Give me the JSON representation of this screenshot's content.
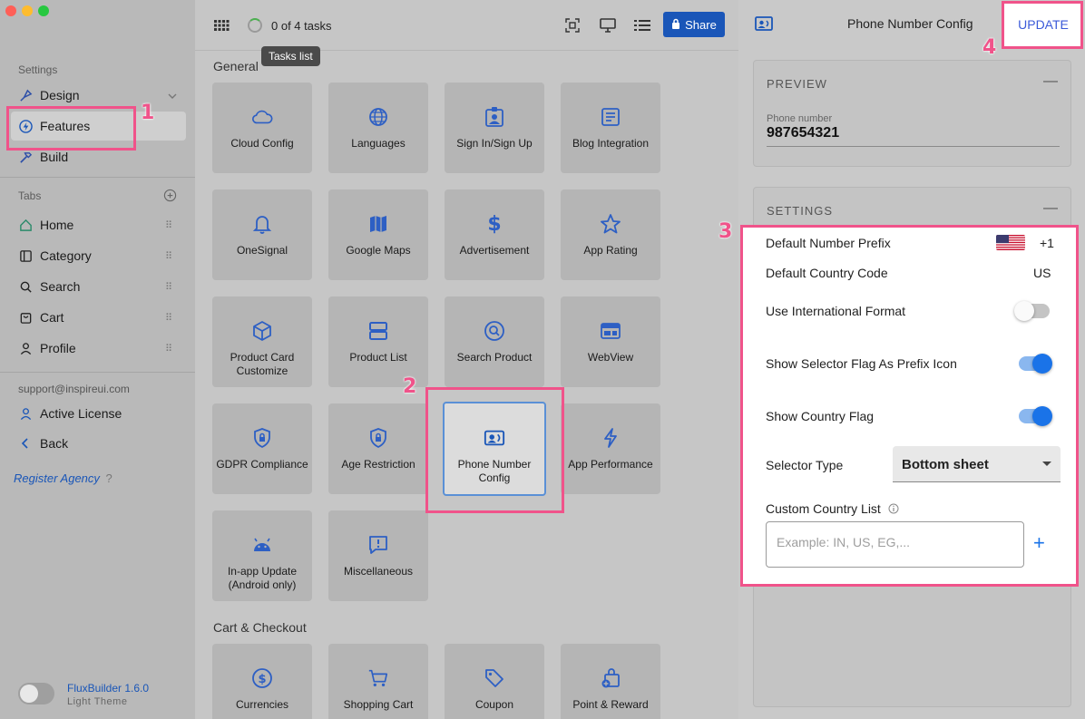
{
  "window": {
    "traffic_colors": [
      "#ff5f57",
      "#febc2e",
      "#28c840"
    ]
  },
  "sidebar": {
    "settings_header": "Settings",
    "settings_items": [
      {
        "label": "Design",
        "icon": "paintbrush-icon"
      },
      {
        "label": "Features",
        "icon": "bolt-icon"
      },
      {
        "label": "Build",
        "icon": "hammer-icon"
      }
    ],
    "tabs_header": "Tabs",
    "tabs": [
      {
        "label": "Home",
        "icon": "home-icon"
      },
      {
        "label": "Category",
        "icon": "category-icon"
      },
      {
        "label": "Search",
        "icon": "search-icon"
      },
      {
        "label": "Cart",
        "icon": "cart-icon"
      },
      {
        "label": "Profile",
        "icon": "person-icon"
      }
    ],
    "support_email": "support@inspireui.com",
    "active_license": "Active License",
    "back": "Back",
    "register_agency": "Register Agency",
    "register_help": "?",
    "app_version": "FluxBuilder 1.6.0",
    "theme_label": "Light Theme"
  },
  "annotations": [
    "1",
    "2",
    "3",
    "4"
  ],
  "topbar": {
    "tasks": "0 of 4 tasks",
    "tooltip": "Tasks list",
    "share": "Share"
  },
  "groups": {
    "general": "General",
    "cart_checkout": "Cart & Checkout"
  },
  "tiles": {
    "general": [
      {
        "label": "Cloud Config",
        "icon": "cloud-icon"
      },
      {
        "label": "Languages",
        "icon": "globe-icon"
      },
      {
        "label": "Sign In/Sign Up",
        "icon": "badge-icon"
      },
      {
        "label": "Blog Integration",
        "icon": "article-icon"
      },
      {
        "label": "OneSignal",
        "icon": "bell-icon"
      },
      {
        "label": "Google Maps",
        "icon": "map-icon"
      },
      {
        "label": "Advertisement",
        "icon": "dollar-icon"
      },
      {
        "label": "App Rating",
        "icon": "star-icon"
      },
      {
        "label": "Product Card Customize",
        "icon": "cube-icon"
      },
      {
        "label": "Product List",
        "icon": "list-icon"
      },
      {
        "label": "Search Product",
        "icon": "search-circle-icon"
      },
      {
        "label": "WebView",
        "icon": "web-icon"
      },
      {
        "label": "GDPR Compliance",
        "icon": "shield-lock-icon"
      },
      {
        "label": "Age Restriction",
        "icon": "shield-lock-icon"
      },
      {
        "label": "Phone Number Config",
        "icon": "contact-card-icon"
      },
      {
        "label": "App Performance",
        "icon": "lightning-icon"
      },
      {
        "label": "In-app Update (Android only)",
        "icon": "android-icon"
      },
      {
        "label": "Miscellaneous",
        "icon": "chat-alert-icon"
      }
    ],
    "cart_checkout": [
      {
        "label": "Currencies",
        "icon": "currency-icon"
      },
      {
        "label": "Shopping Cart",
        "icon": "shopping-cart-icon"
      },
      {
        "label": "Coupon",
        "icon": "tag-icon"
      },
      {
        "label": "Point & Reward",
        "icon": "gift-icon"
      }
    ]
  },
  "right_panel": {
    "title": "Phone Number Config",
    "update": "UPDATE",
    "preview": {
      "header": "PREVIEW",
      "collapse": "—",
      "phone_label": "Phone number",
      "phone_value": "987654321"
    },
    "settings": {
      "header": "SETTINGS",
      "collapse": "—",
      "default_prefix_label": "Default Number Prefix",
      "default_prefix_value": "+1",
      "default_country_label": "Default Country Code",
      "default_country_value": "US",
      "intl_format_label": "Use International Format",
      "intl_format_on": false,
      "selector_flag_label": "Show Selector Flag As Prefix Icon",
      "selector_flag_on": true,
      "country_flag_label": "Show Country Flag",
      "country_flag_on": true,
      "selector_type_label": "Selector Type",
      "selector_type_value": "Bottom sheet",
      "custom_list_label": "Custom Country List",
      "custom_list_placeholder": "Example: IN, US, EG,...",
      "add": "+"
    }
  },
  "colors": {
    "accent": "#1a56b8",
    "toggle_on": "#1a73e8",
    "annotation": "#f0538a"
  }
}
